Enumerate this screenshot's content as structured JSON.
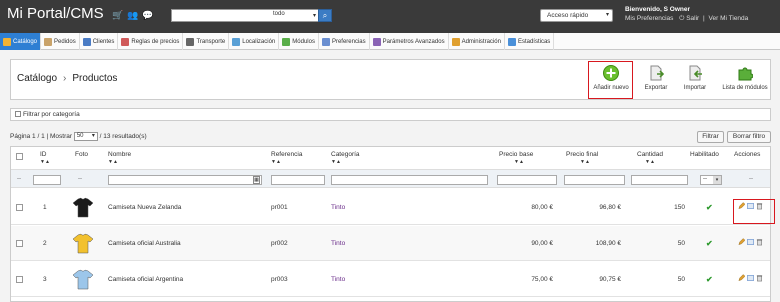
{
  "topbar": {
    "brand": "Mi Portal/CMS",
    "search_value": "",
    "search_scope": "todo",
    "quick_access": "Acceso rápido",
    "greeting": "Bienvenido, S Owner",
    "prefs": "Mis Preferencias",
    "logout": "Salir",
    "view_shop": "Ver Mi Tienda"
  },
  "tabs": [
    {
      "label": "Catálogo",
      "color": "#f2b233"
    },
    {
      "label": "Pedidos",
      "color": "#c9a36a"
    },
    {
      "label": "Clientes",
      "color": "#4a7bc4"
    },
    {
      "label": "Reglas de precios",
      "color": "#d05a5a"
    },
    {
      "label": "Transporte",
      "color": "#666666"
    },
    {
      "label": "Localización",
      "color": "#5aa0d6"
    },
    {
      "label": "Módulos",
      "color": "#5aae4a"
    },
    {
      "label": "Preferencias",
      "color": "#6b8fd1"
    },
    {
      "label": "Parámetros Avanzados",
      "color": "#8a63b5"
    },
    {
      "label": "Administración",
      "color": "#e0a030"
    },
    {
      "label": "Estadísticas",
      "color": "#4a90d9"
    }
  ],
  "header": {
    "breadcrumb_1": "Catálogo",
    "breadcrumb_sep": "›",
    "breadcrumb_2": "Productos",
    "tools": {
      "add": "Añadir nuevo",
      "export": "Exportar",
      "import": "Importar",
      "modules": "Lista de módulos"
    }
  },
  "filter_by_category": "Filtrar por categoría",
  "pagination": {
    "prefix": "Página 1 / 1 | Mostrar",
    "per_page": "50",
    "suffix": "/ 13 resultado(s)"
  },
  "buttons": {
    "filter": "Filtrar",
    "reset": "Borrar filtro"
  },
  "columns": {
    "id": "ID",
    "photo": "Foto",
    "name": "Nombre",
    "reference": "Referencia",
    "category": "Categoría",
    "base_price": "Precio base",
    "final_price": "Precio final",
    "quantity": "Cantidad",
    "enabled": "Habilitado",
    "actions": "Acciones"
  },
  "filter_dash": "--",
  "rows": [
    {
      "id": "1",
      "name": "Camiseta Nueva Zelanda",
      "reference": "pr001",
      "category": "Tinto",
      "base_price": "80,00 €",
      "final_price": "96,80 €",
      "quantity": "150",
      "shirt_color": "#1a1a1a"
    },
    {
      "id": "2",
      "name": "Camiseta oficial Australia",
      "reference": "pr002",
      "category": "Tinto",
      "base_price": "90,00 €",
      "final_price": "108,90 €",
      "quantity": "50",
      "shirt_color": "#f2c12e"
    },
    {
      "id": "3",
      "name": "Camiseta oficial Argentina",
      "reference": "pr003",
      "category": "Tinto",
      "base_price": "75,00 €",
      "final_price": "90,75 €",
      "quantity": "50",
      "shirt_color": "#9cc6ea"
    }
  ]
}
